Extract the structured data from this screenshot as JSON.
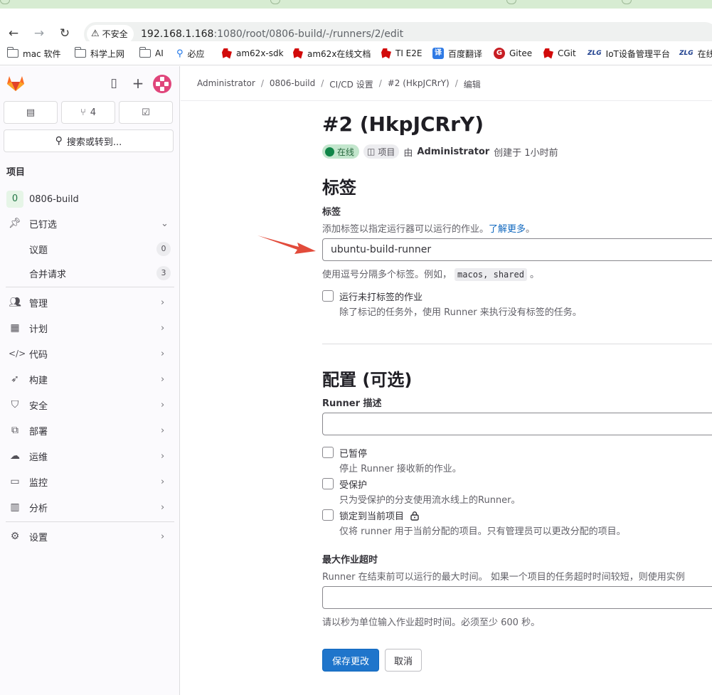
{
  "browser": {
    "security_label": "不安全",
    "url_host": "192.168.1.168",
    "url_rest": ":1080/root/0806-build/-/runners/2/edit",
    "bookmarks": [
      {
        "label": "mac 软件",
        "icon": "folder-icon"
      },
      {
        "label": "科学上网",
        "icon": "folder-icon"
      },
      {
        "label": "AI",
        "icon": "folder-icon"
      },
      {
        "label": "必应",
        "icon": "search-icon"
      },
      {
        "label": "am62x-sdk",
        "icon": "ti-icon"
      },
      {
        "label": "am62x在线文档",
        "icon": "ti-icon"
      },
      {
        "label": "TI E2E",
        "icon": "ti-icon"
      },
      {
        "label": "百度翻译",
        "icon": "translate-icon",
        "glyph": "译"
      },
      {
        "label": "Gitee",
        "icon": "gitee-icon",
        "glyph": "G"
      },
      {
        "label": "CGit",
        "icon": "ti-icon"
      },
      {
        "label": "IoT设备管理平台",
        "icon": "zlg-icon",
        "glyph": "ZLG"
      },
      {
        "label": "在线",
        "icon": "zlg-icon",
        "glyph": "ZLG"
      }
    ]
  },
  "sidebar": {
    "merge_requests_count": "4",
    "search_label": "搜索或转到...",
    "section_title": "项目",
    "project": {
      "badge": "0",
      "name": "0806-build"
    },
    "pinned": {
      "label": "已钉选",
      "items": [
        {
          "label": "议题",
          "count": "0"
        },
        {
          "label": "合并请求",
          "count": "3"
        }
      ]
    },
    "items": [
      {
        "label": "管理",
        "icon": "users-icon"
      },
      {
        "label": "计划",
        "icon": "calendar-icon"
      },
      {
        "label": "代码",
        "icon": "code-icon"
      },
      {
        "label": "构建",
        "icon": "rocket-icon"
      },
      {
        "label": "安全",
        "icon": "shield-icon"
      },
      {
        "label": "部署",
        "icon": "deployments-icon"
      },
      {
        "label": "运维",
        "icon": "cloud-gear-icon"
      },
      {
        "label": "监控",
        "icon": "monitor-icon"
      },
      {
        "label": "分析",
        "icon": "chart-icon"
      }
    ],
    "settings": {
      "label": "设置",
      "icon": "settings-icon"
    }
  },
  "breadcrumbs": [
    "Administrator",
    "0806-build",
    "CI/CD 设置",
    "#2 (HkpJCRrY)",
    "编辑"
  ],
  "runner": {
    "title": "#2 (HkpJCRrY)",
    "status": "在线",
    "type": "项目",
    "by": "由",
    "author": "Administrator",
    "created": "创建于 1小时前"
  },
  "tags_section": {
    "heading": "标签",
    "label": "标签",
    "help": "添加标签以指定运行器可以运行的作业。",
    "learn_more": "了解更多",
    "value": "ubuntu-build-runner",
    "hint_prefix": "使用逗号分隔多个标签。例如，",
    "hint_code": "macos, shared",
    "hint_suffix": "。",
    "untagged_label": "运行未打标签的作业",
    "untagged_help": "除了标记的任务外，使用 Runner 来执行没有标签的任务。"
  },
  "config_section": {
    "heading": "配置 (可选)",
    "description_label": "Runner 描述",
    "description_value": "",
    "paused_label": "已暂停",
    "paused_help": "停止 Runner 接收新的作业。",
    "protected_label": "受保护",
    "protected_help": "只为受保护的分支使用流水线上的Runner。",
    "locked_label": "锁定到当前项目",
    "locked_help": "仅将 runner 用于当前分配的项目。只有管理员可以更改分配的项目。",
    "timeout_label": "最大作业超时",
    "timeout_help": "Runner 在结束前可以运行的最大时间。 如果一个项目的任务超时时间较短，则使用实例",
    "timeout_value": "",
    "timeout_hint": "请以秒为单位输入作业超时时间。必须至少 600 秒。"
  },
  "actions": {
    "save": "保存更改",
    "cancel": "取消"
  },
  "colors": {
    "accent": "#1f75cb",
    "online": "#108548",
    "annotation_arrow": "#e24b3b"
  }
}
